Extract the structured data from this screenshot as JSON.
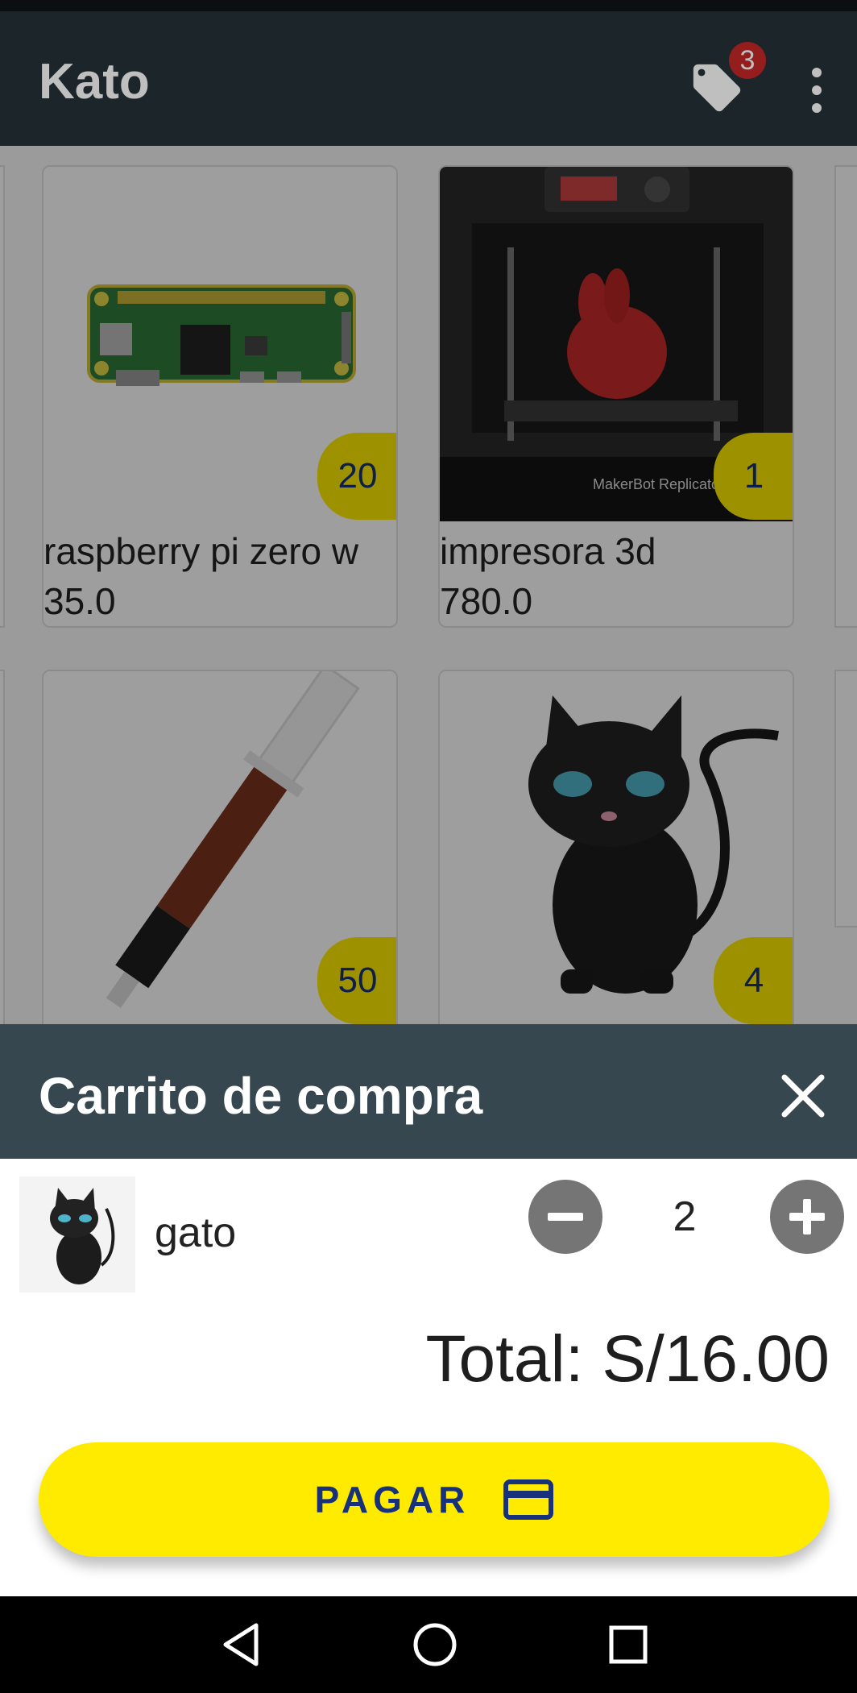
{
  "app_bar": {
    "title": "Kato",
    "cart_count": "3",
    "icons": {
      "cart": "tag-icon",
      "more": "more-vert-icon"
    }
  },
  "products": [
    {
      "name": "raspberry pi zero w",
      "price": "35.0",
      "stock": "20",
      "image": "raspberry-pi-image"
    },
    {
      "name": "impresora 3d",
      "price": "780.0",
      "stock": "1",
      "image": "3d-printer-image"
    },
    {
      "name": "",
      "price": "",
      "stock": "50",
      "image": "thermal-paste-image"
    },
    {
      "name": "",
      "price": "",
      "stock": "4",
      "image": "cat-figure-image"
    }
  ],
  "cart_sheet": {
    "title": "Carrito de compra",
    "close_icon": "close-icon",
    "items": [
      {
        "name": "gato",
        "quantity": "2",
        "image": "cat-figure-image"
      }
    ],
    "total": "Total: S/16.00",
    "pay_label": "PAGAR",
    "pay_icon": "credit-card-icon"
  },
  "colors": {
    "app_bar": "#263238",
    "sheet_header": "#37474f",
    "accent_yellow": "#ffeb00",
    "navy_text": "#17317a",
    "badge_red": "#c62828"
  },
  "nav_bar": {
    "icons": [
      "back-icon",
      "home-icon",
      "recents-icon"
    ]
  }
}
